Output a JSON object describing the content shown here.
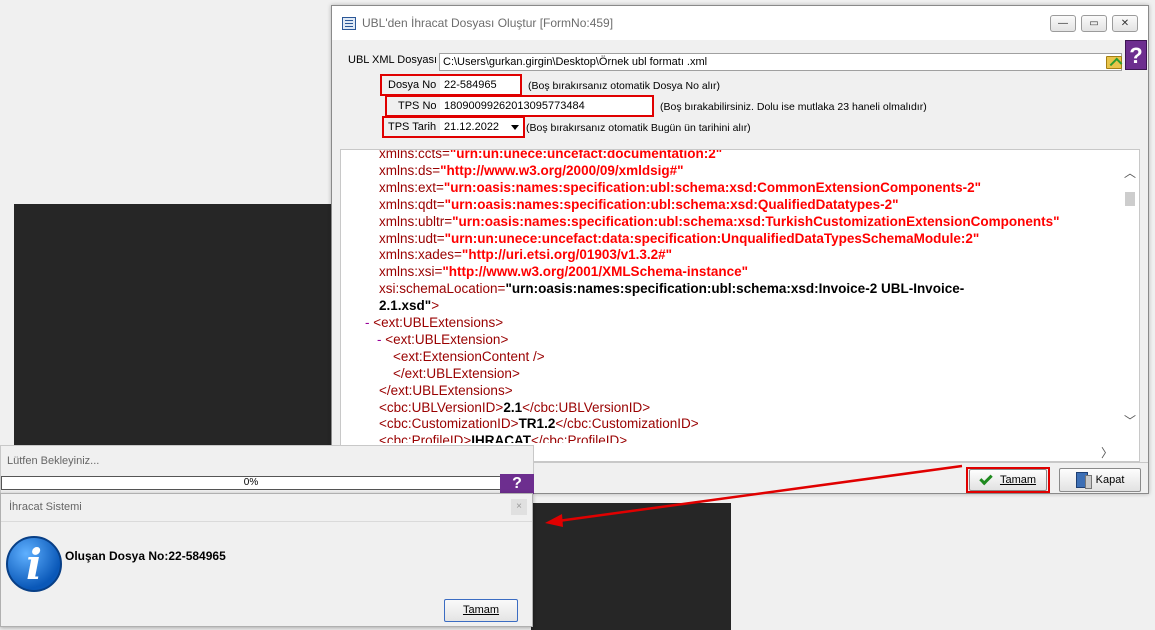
{
  "window": {
    "title": "UBL'den İhracat Dosyası Oluştur [FormNo:459]",
    "btn_min": "—",
    "btn_max": "▭",
    "btn_close": "✕",
    "help_label": "?"
  },
  "form": {
    "xml_label": "UBL XML Dosyası",
    "xml_path": "C:\\Users\\gurkan.girgin\\Desktop\\Örnek ubl formatı .xml",
    "dosya_label": "Dosya No",
    "dosya_value": "22-584965",
    "dosya_hint": "(Boş bırakırsanız otomatik Dosya No alır)",
    "tps_label": "TPS No",
    "tps_value": "18090099262013095773484",
    "tps_hint": "(Boş bırakabilirsiniz. Dolu ise mutlaka 23 haneli olmalıdır)",
    "tarih_label": "TPS Tarih",
    "tarih_value": "21.12.2022",
    "tarih_hint": "(Boş bırakırsanız otomatik Bugün ün tarihini alır)"
  },
  "xml_lines": [
    {
      "ind": "",
      "a": "xmlns:ccts=",
      "b": "\"urn:un:unece:uncefact:documentation:2\""
    },
    {
      "ind": "",
      "a": "xmlns:ds=",
      "b": "\"http://www.w3.org/2000/09/xmldsig#\""
    },
    {
      "ind": "",
      "a": "xmlns:ext=",
      "b": "\"urn:oasis:names:specification:ubl:schema:xsd:CommonExtensionComponents-2\""
    },
    {
      "ind": "",
      "a": "xmlns:qdt=",
      "b": "\"urn:oasis:names:specification:ubl:schema:xsd:QualifiedDatatypes-2\""
    },
    {
      "ind": "",
      "a": "xmlns:ubltr=",
      "b": "\"urn:oasis:names:specification:ubl:schema:xsd:TurkishCustomizationExtensionComponents\""
    },
    {
      "ind": "",
      "a": "xmlns:udt=",
      "b": "\"urn:un:unece:uncefact:data:specification:UnqualifiedDataTypesSchemaModule:2\""
    },
    {
      "ind": "",
      "a": "xmlns:xades=",
      "b": "\"http://uri.etsi.org/01903/v1.3.2#\""
    },
    {
      "ind": "",
      "a": "xmlns:xsi=",
      "b": "\"http://www.w3.org/2001/XMLSchema-instance\""
    },
    {
      "ind": "",
      "a": "xsi:schemaLocation=",
      "b": "\"urn:oasis:names:specification:ubl:schema:xsd:Invoice-2 UBL-Invoice-"
    },
    {
      "ind": "",
      "a": "",
      "b": "2.1.xsd\"",
      "c": ">"
    },
    {
      "ind": "- ",
      "a": "<ext:UBLExtensions>",
      "b": ""
    },
    {
      "ind": "  - ",
      "a": "<ext:UBLExtension>",
      "b": ""
    },
    {
      "ind": "",
      "a": "<ext:ExtensionContent />",
      "b": ""
    },
    {
      "ind": "",
      "a": "</ext:UBLExtension>",
      "b": ""
    },
    {
      "ind": "",
      "a": "</ext:UBLExtensions>",
      "b": ""
    },
    {
      "ind": "",
      "a": "<cbc:UBLVersionID>",
      "b": "2.1",
      "c": "</cbc:UBLVersionID>"
    },
    {
      "ind": "",
      "a": "<cbc:CustomizationID>",
      "b": "TR1.2",
      "c": "</cbc:CustomizationID>"
    },
    {
      "ind": "",
      "a": "<cbc:ProfileID>",
      "b": "IHRACAT",
      "c": "</cbc:ProfileID>"
    }
  ],
  "buttons": {
    "tamam_label": "Tamam",
    "kapat_label": "Kapat"
  },
  "progress": {
    "title": "Lütfen Bekleyiniz...",
    "value_text": "0%",
    "percent": 0,
    "help_label": "?"
  },
  "info_dialog": {
    "title": "İhracat Sistemi",
    "close_label": "×",
    "icon_glyph": "i",
    "message": "Oluşan Dosya No:22-584965",
    "ok_label": "Tamam"
  },
  "colors": {
    "highlight": "#e00000",
    "tag": "#990000",
    "value": "#ff0000",
    "accent": "#6d2e8f"
  }
}
